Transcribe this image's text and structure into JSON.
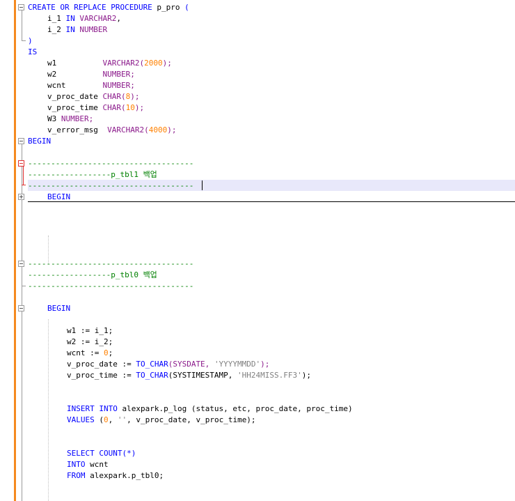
{
  "editor": {
    "lines": [
      {
        "n": 0,
        "indent": 0,
        "tokens": [
          {
            "t": "CREATE OR REPLACE PROCEDURE",
            "c": "kw"
          },
          {
            "t": " p_pro ",
            "c": "pl"
          },
          {
            "t": "(",
            "c": "kw"
          }
        ]
      },
      {
        "n": 1,
        "indent": 4,
        "tokens": [
          {
            "t": "i_1 ",
            "c": "pl"
          },
          {
            "t": "IN",
            "c": "kw"
          },
          {
            "t": " ",
            "c": "pl"
          },
          {
            "t": "VARCHAR2",
            "c": "ty"
          },
          {
            "t": ",",
            "c": "pl"
          }
        ]
      },
      {
        "n": 2,
        "indent": 4,
        "tokens": [
          {
            "t": "i_2 ",
            "c": "pl"
          },
          {
            "t": "IN",
            "c": "kw"
          },
          {
            "t": " ",
            "c": "pl"
          },
          {
            "t": "NUMBER",
            "c": "ty"
          }
        ]
      },
      {
        "n": 3,
        "indent": 0,
        "tokens": [
          {
            "t": ")",
            "c": "kw"
          }
        ]
      },
      {
        "n": 4,
        "indent": 0,
        "tokens": [
          {
            "t": "IS",
            "c": "kw"
          }
        ]
      },
      {
        "n": 5,
        "indent": 4,
        "tokens": [
          {
            "t": "w1          ",
            "c": "pl"
          },
          {
            "t": "VARCHAR2",
            "c": "ty"
          },
          {
            "t": "(",
            "c": "ty"
          },
          {
            "t": "2000",
            "c": "num"
          },
          {
            "t": ");",
            "c": "ty"
          }
        ]
      },
      {
        "n": 6,
        "indent": 4,
        "tokens": [
          {
            "t": "w2          ",
            "c": "pl"
          },
          {
            "t": "NUMBER",
            "c": "ty"
          },
          {
            "t": ";",
            "c": "ty"
          }
        ]
      },
      {
        "n": 7,
        "indent": 4,
        "tokens": [
          {
            "t": "wcnt        ",
            "c": "pl"
          },
          {
            "t": "NUMBER",
            "c": "ty"
          },
          {
            "t": ";",
            "c": "ty"
          }
        ]
      },
      {
        "n": 8,
        "indent": 4,
        "tokens": [
          {
            "t": "v_proc_date ",
            "c": "pl"
          },
          {
            "t": "CHAR",
            "c": "ty"
          },
          {
            "t": "(",
            "c": "ty"
          },
          {
            "t": "8",
            "c": "num"
          },
          {
            "t": ");",
            "c": "ty"
          }
        ]
      },
      {
        "n": 9,
        "indent": 4,
        "tokens": [
          {
            "t": "v_proc_time ",
            "c": "pl"
          },
          {
            "t": "CHAR",
            "c": "ty"
          },
          {
            "t": "(",
            "c": "ty"
          },
          {
            "t": "10",
            "c": "num"
          },
          {
            "t": ");",
            "c": "ty"
          }
        ]
      },
      {
        "n": 10,
        "indent": 4,
        "tokens": [
          {
            "t": "W3 ",
            "c": "pl"
          },
          {
            "t": "NUMBER",
            "c": "ty"
          },
          {
            "t": ";",
            "c": "ty"
          }
        ]
      },
      {
        "n": 11,
        "indent": 4,
        "tokens": [
          {
            "t": "v_error_msg  ",
            "c": "pl"
          },
          {
            "t": "VARCHAR2",
            "c": "ty"
          },
          {
            "t": "(",
            "c": "ty"
          },
          {
            "t": "4000",
            "c": "num"
          },
          {
            "t": ");",
            "c": "ty"
          }
        ]
      },
      {
        "n": 12,
        "indent": 0,
        "tokens": [
          {
            "t": "BEGIN",
            "c": "kw"
          }
        ]
      },
      {
        "n": 14,
        "indent": 0,
        "tokens": [
          {
            "t": "------------------------------------",
            "c": "cm"
          }
        ]
      },
      {
        "n": 15,
        "indent": 0,
        "tokens": [
          {
            "t": "------------------p_tbl1 백업",
            "c": "cm"
          }
        ]
      },
      {
        "n": 16,
        "indent": 0,
        "tokens": [
          {
            "t": "------------------------------------",
            "c": "cm"
          }
        ]
      },
      {
        "n": 17,
        "indent": 4,
        "tokens": [
          {
            "t": "BEGIN",
            "c": "kw"
          }
        ]
      },
      {
        "n": 23,
        "indent": 0,
        "tokens": [
          {
            "t": "------------------------------------",
            "c": "cm"
          }
        ]
      },
      {
        "n": 24,
        "indent": 0,
        "tokens": [
          {
            "t": "------------------p_tbl0 백업",
            "c": "cm"
          }
        ]
      },
      {
        "n": 25,
        "indent": 0,
        "tokens": [
          {
            "t": "------------------------------------",
            "c": "cm"
          }
        ]
      },
      {
        "n": 27,
        "indent": 4,
        "tokens": [
          {
            "t": "BEGIN",
            "c": "kw"
          }
        ]
      },
      {
        "n": 29,
        "indent": 8,
        "tokens": [
          {
            "t": "w1 := i_1;",
            "c": "pl"
          }
        ]
      },
      {
        "n": 30,
        "indent": 8,
        "tokens": [
          {
            "t": "w2 := i_2;",
            "c": "pl"
          }
        ]
      },
      {
        "n": 31,
        "indent": 8,
        "tokens": [
          {
            "t": "wcnt := ",
            "c": "pl"
          },
          {
            "t": "0",
            "c": "num"
          },
          {
            "t": ";",
            "c": "pl"
          }
        ]
      },
      {
        "n": 32,
        "indent": 8,
        "tokens": [
          {
            "t": "v_proc_date := ",
            "c": "pl"
          },
          {
            "t": "TO_CHAR",
            "c": "fn"
          },
          {
            "t": "(SYSDATE, ",
            "c": "ty"
          },
          {
            "t": "'YYYYMMDD'",
            "c": "str"
          },
          {
            "t": ");",
            "c": "ty"
          }
        ]
      },
      {
        "n": 33,
        "indent": 8,
        "tokens": [
          {
            "t": "v_proc_time := ",
            "c": "pl"
          },
          {
            "t": "TO_CHAR",
            "c": "fn"
          },
          {
            "t": "(SYSTIMESTAMP, ",
            "c": "pl"
          },
          {
            "t": "'HH24MISS.FF3'",
            "c": "str"
          },
          {
            "t": ");",
            "c": "pl"
          }
        ]
      },
      {
        "n": 36,
        "indent": 8,
        "tokens": [
          {
            "t": "INSERT INTO",
            "c": "kw"
          },
          {
            "t": " alexpark.p_log (status, etc, proc_date, proc_time)",
            "c": "pl"
          }
        ]
      },
      {
        "n": 37,
        "indent": 8,
        "tokens": [
          {
            "t": "VALUES",
            "c": "kw"
          },
          {
            "t": " (",
            "c": "pl"
          },
          {
            "t": "0",
            "c": "num"
          },
          {
            "t": ", ",
            "c": "pl"
          },
          {
            "t": "''",
            "c": "str"
          },
          {
            "t": ", v_proc_date, v_proc_time);",
            "c": "pl"
          }
        ]
      },
      {
        "n": 40,
        "indent": 8,
        "tokens": [
          {
            "t": "SELECT",
            "c": "kw"
          },
          {
            "t": " ",
            "c": "pl"
          },
          {
            "t": "COUNT",
            "c": "fn"
          },
          {
            "t": "(*)",
            "c": "kw"
          }
        ]
      },
      {
        "n": 41,
        "indent": 8,
        "tokens": [
          {
            "t": "INTO",
            "c": "kw"
          },
          {
            "t": " wcnt",
            "c": "pl"
          }
        ]
      },
      {
        "n": 42,
        "indent": 8,
        "tokens": [
          {
            "t": "FROM",
            "c": "kw"
          },
          {
            "t": " alexpark.p_tbl0;",
            "c": "pl"
          }
        ]
      }
    ]
  },
  "colors": {
    "keyword": "#0000ff",
    "type": "#8b1a8b",
    "number": "#ff8000",
    "string": "#808080",
    "comment": "#008000",
    "gutter_accent": "#f58a1f",
    "current_line": "#e8e8fa"
  },
  "icons": [
    "fold-minus-icon",
    "fold-plus-icon"
  ]
}
